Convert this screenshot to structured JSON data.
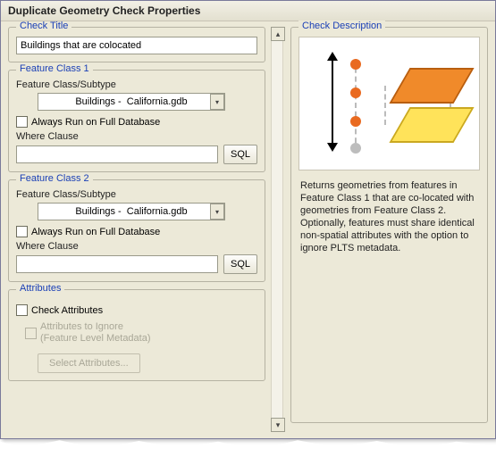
{
  "window": {
    "title": "Duplicate Geometry Check Properties"
  },
  "checkTitle": {
    "legend": "Check Title",
    "value": "Buildings that are colocated"
  },
  "fc1": {
    "legend": "Feature Class 1",
    "subtype_label": "Feature Class/Subtype",
    "combo_value": "Buildings -  California.gdb",
    "always_full": "Always Run on Full Database",
    "where_label": "Where Clause",
    "where_value": "",
    "sql_label": "SQL"
  },
  "fc2": {
    "legend": "Feature Class 2",
    "subtype_label": "Feature Class/Subtype",
    "combo_value": "Buildings -  California.gdb",
    "always_full": "Always Run on Full Database",
    "where_label": "Where Clause",
    "where_value": "",
    "sql_label": "SQL"
  },
  "attributes": {
    "legend": "Attributes",
    "check_label": "Check Attributes",
    "ignore_line1": "Attributes to Ignore",
    "ignore_line2": "(Feature Level Metadata)",
    "select_btn": "Select Attributes..."
  },
  "description": {
    "legend": "Check Description",
    "text": "Returns geometries from features in Feature Class 1 that are co-located with geometries from Feature Class 2. Optionally, features must share identical non-spatial attributes with the option to ignore PLTS metadata."
  }
}
